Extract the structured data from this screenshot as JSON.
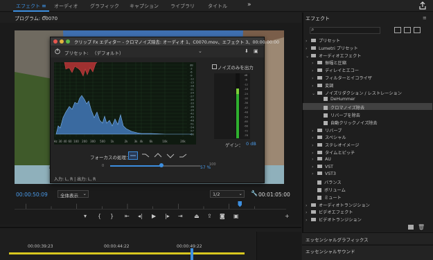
{
  "workspace_tabs": [
    "エフェクト",
    "オーディオ",
    "グラフィック",
    "キャプション",
    "ライブラリ",
    "タイトル"
  ],
  "program": {
    "title": "プログラム: C0070",
    "menu_icon": "hamburger-icon",
    "timecode_current": "00:00:50:09",
    "fit_label": "全体表示",
    "resolution": "1/2",
    "timecode_duration": "00:01:05:00"
  },
  "dialog": {
    "title": "クリップ Fx エディター - クロマノイズ除去: オーディオ 1、C0070.mov、エフェクト 3、00:00:00:00",
    "preset_label": "プリセット:",
    "preset_value": "（デフォルト）",
    "only_noise_label": "ノイズのみを出力",
    "graph_db_ticks": [
      "dB",
      "-3",
      "-6",
      "-9",
      "-12",
      "-15",
      "-18",
      "-21",
      "-24",
      "-27",
      "-30",
      "-33",
      "-36",
      "-39",
      "-42",
      "-45",
      "-48",
      "-51",
      "-54",
      "-57",
      "-60"
    ],
    "graph_freq_ticks": [
      "Hz",
      "30",
      "40",
      "60",
      "100",
      "200",
      "300",
      "500",
      "1k",
      "2k",
      "3k",
      "4k",
      "6k",
      "10k",
      "20k"
    ],
    "meter_ticks": [
      "dB",
      "-6",
      "-12",
      "-18",
      "-24",
      "-30",
      "-36",
      "-42",
      "-48",
      "-54",
      "-60",
      "-66",
      "-72",
      "-78"
    ],
    "gain_label": "ゲイン：",
    "gain_value": "0 dB",
    "focus_label": "フォーカスの処理：",
    "slider_min": "0",
    "slider_max": "100",
    "slider_value_label": "57 %",
    "slider_value": 57,
    "io_label": "入力: L, R | 出力: L, R"
  },
  "timeline": {
    "times": [
      "00:00:39:23",
      "00:00:44:22",
      "00:00:49:22"
    ]
  },
  "effects_panel": {
    "title": "エフェクト",
    "items": [
      {
        "label": "プリセット",
        "kind": "folder",
        "depth": 0,
        "arrow": "›"
      },
      {
        "label": "Lumetri プリセット",
        "kind": "folder",
        "depth": 0,
        "arrow": "›"
      },
      {
        "label": "オーディオエフェクト",
        "kind": "folder",
        "depth": 0,
        "arrow": "⌄"
      },
      {
        "label": "振幅と圧縮",
        "kind": "folder",
        "depth": 1,
        "arrow": "›"
      },
      {
        "label": "ディレイとエコー",
        "kind": "folder",
        "depth": 1,
        "arrow": "›"
      },
      {
        "label": "フィルターとイコライザ",
        "kind": "folder",
        "depth": 1,
        "arrow": "›"
      },
      {
        "label": "変調",
        "kind": "folder",
        "depth": 1,
        "arrow": "›"
      },
      {
        "label": "ノイズリダクション / レストレーション",
        "kind": "folder",
        "depth": 1,
        "arrow": "⌄"
      },
      {
        "label": "DeHummer",
        "kind": "file",
        "depth": 2,
        "arrow": ""
      },
      {
        "label": "クロマノイズ除去",
        "kind": "file",
        "depth": 2,
        "arrow": ""
      },
      {
        "label": "リバーブを除去",
        "kind": "file",
        "depth": 2,
        "arrow": ""
      },
      {
        "label": "自動クリックノイズ除去",
        "kind": "file",
        "depth": 2,
        "arrow": ""
      },
      {
        "label": "リバーブ",
        "kind": "folder",
        "depth": 1,
        "arrow": "›"
      },
      {
        "label": "スペシャル",
        "kind": "folder",
        "depth": 1,
        "arrow": "›"
      },
      {
        "label": "ステレオイメージ",
        "kind": "folder",
        "depth": 1,
        "arrow": "›"
      },
      {
        "label": "タイムとピッチ",
        "kind": "folder",
        "depth": 1,
        "arrow": "›"
      },
      {
        "label": "AU",
        "kind": "folder",
        "depth": 1,
        "arrow": "›"
      },
      {
        "label": "VST",
        "kind": "folder",
        "depth": 1,
        "arrow": "›"
      },
      {
        "label": "VST3",
        "kind": "folder",
        "depth": 1,
        "arrow": "›"
      },
      {
        "label": "バランス",
        "kind": "file",
        "depth": 1,
        "arrow": ""
      },
      {
        "label": "ボリューム",
        "kind": "file",
        "depth": 1,
        "arrow": ""
      },
      {
        "label": "ミュート",
        "kind": "file",
        "depth": 1,
        "arrow": ""
      },
      {
        "label": "オーディオトランジション",
        "kind": "folder",
        "depth": 0,
        "arrow": "›"
      },
      {
        "label": "ビデオエフェクト",
        "kind": "folder",
        "depth": 0,
        "arrow": "›"
      },
      {
        "label": "ビデオトランジション",
        "kind": "folder",
        "depth": 0,
        "arrow": "›"
      }
    ],
    "bottom_panels": [
      "エッセンシャルグラフィックス",
      "エッセンシャルサウンド"
    ]
  }
}
